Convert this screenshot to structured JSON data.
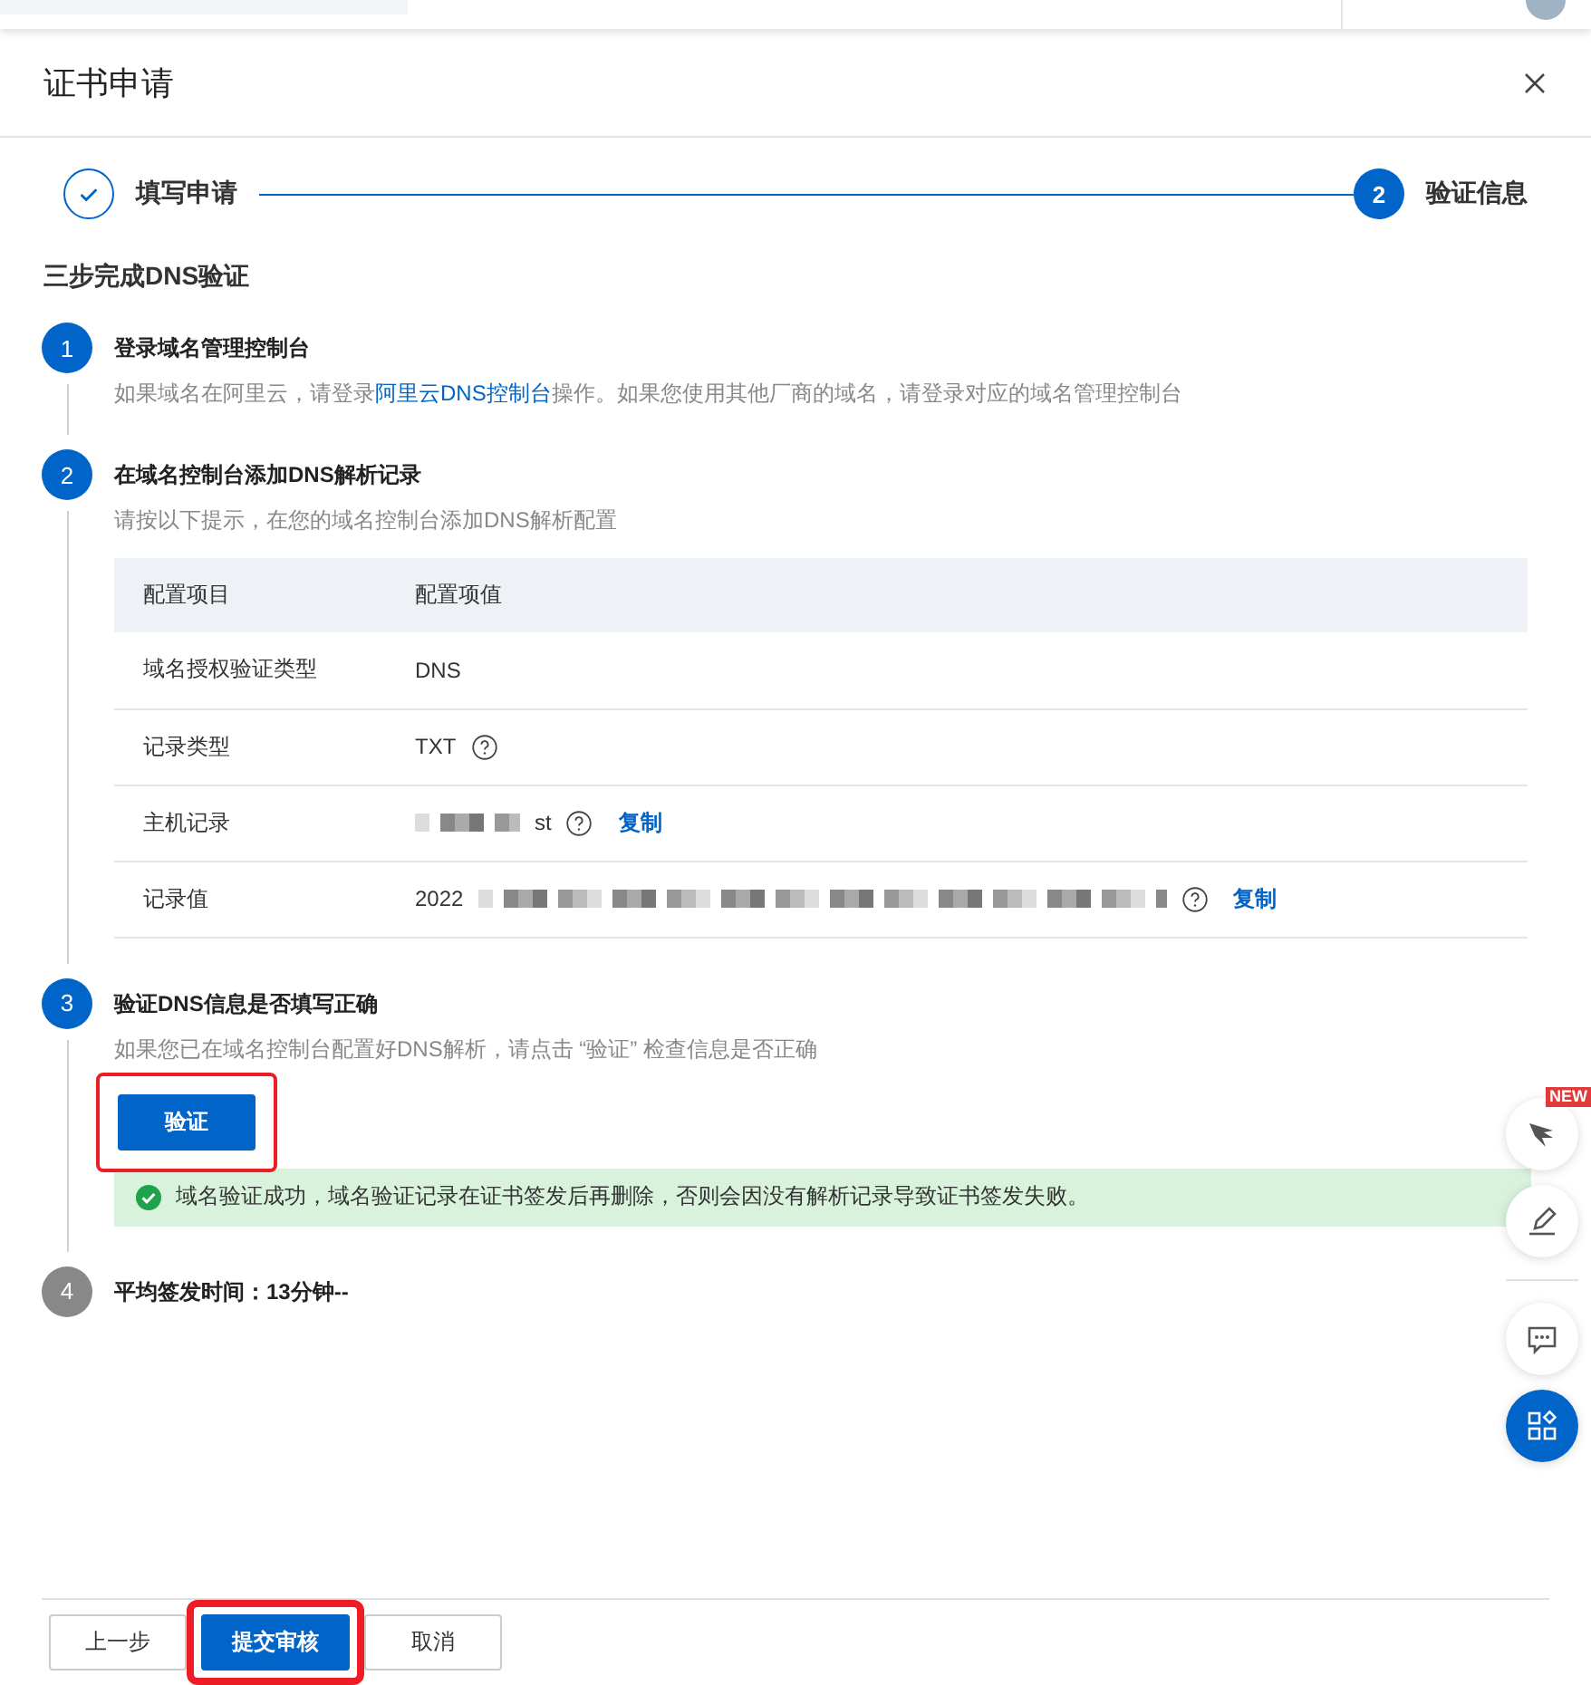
{
  "dialog": {
    "title": "证书申请"
  },
  "progress": [
    {
      "label": "填写申请",
      "completed": true
    },
    {
      "label": "验证信息",
      "completed": false,
      "number": "2"
    }
  ],
  "section_title": "三步完成DNS验证",
  "steps": [
    {
      "number": "1",
      "active": true,
      "title": "登录域名管理控制台",
      "description": {
        "before": "如果域名在阿里云，请登录",
        "link": "阿里云DNS控制台",
        "after": "操作。如果您使用其他厂商的域名，请登录对应的域名管理控制台"
      }
    },
    {
      "number": "2",
      "active": true,
      "title": "在域名控制台添加DNS解析记录",
      "description": {
        "before": "请按以下提示，在您的域名控制台添加DNS解析配置"
      },
      "table": {
        "columns": [
          "配置项目",
          "配置项值"
        ],
        "rows": [
          {
            "item": "域名授权验证类型",
            "value": "DNS",
            "help": false,
            "kind": "plain"
          },
          {
            "item": "记录类型",
            "value": "TXT",
            "help": true,
            "kind": "plain"
          },
          {
            "item": "主机记录",
            "value": "st",
            "help": true,
            "copy": "复制",
            "kind": "masked_before"
          },
          {
            "item": "记录值",
            "value": "2022",
            "help": true,
            "copy": "复制",
            "kind": "masked_after"
          }
        ]
      }
    },
    {
      "number": "3",
      "active": true,
      "title": "验证DNS信息是否填写正确",
      "description": {
        "before": "如果您已在域名控制台配置好DNS解析，请点击 “验证” 检查信息是否正确"
      },
      "button": {
        "label": "验证",
        "highlighted": true
      },
      "alert": {
        "kind": "success",
        "text": "域名验证成功，域名验证记录在证书签发后再删除，否则会因没有解析记录导致证书签发失败。"
      }
    },
    {
      "number": "4",
      "active": false,
      "title": "平均签发时间：13分钟--"
    }
  ],
  "footer": {
    "buttons": [
      {
        "label": "上一步",
        "primary": false,
        "highlighted": false
      },
      {
        "label": "提交审核",
        "primary": true,
        "highlighted": true
      },
      {
        "label": "取消",
        "primary": false,
        "highlighted": false
      }
    ]
  },
  "floating_tools": [
    {
      "kind": "bird",
      "badge": "NEW"
    },
    {
      "kind": "pen"
    },
    {
      "kind": "chat"
    },
    {
      "kind": "apps"
    }
  ]
}
